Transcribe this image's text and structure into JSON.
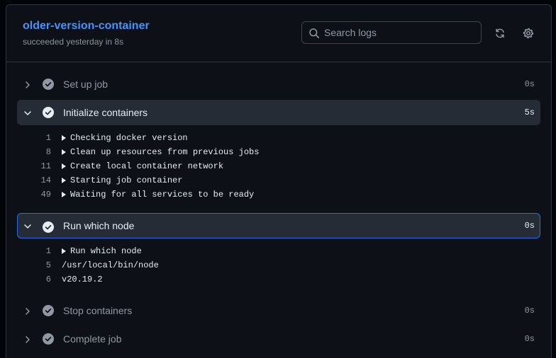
{
  "job": {
    "title": "older-version-container",
    "subtitle": "succeeded yesterday in 8s"
  },
  "search": {
    "placeholder": "Search logs",
    "value": ""
  },
  "icons": {
    "search": "search-icon",
    "refresh": "sync-icon",
    "settings": "gear-icon",
    "chevron_right": "chevron-right-icon",
    "chevron_down": "chevron-down-icon",
    "success": "check-circle-fill-icon"
  },
  "colors": {
    "link": "#4493f8",
    "active_border": "#1f6feb",
    "background": "#0d1117"
  },
  "steps": [
    {
      "name": "Set up job",
      "duration": "0s",
      "expanded": false
    },
    {
      "name": "Initialize containers",
      "duration": "5s",
      "expanded": true,
      "log": [
        {
          "n": "1",
          "text": "Checking docker version",
          "group": true
        },
        {
          "n": "8",
          "text": "Clean up resources from previous jobs",
          "group": true
        },
        {
          "n": "11",
          "text": "Create local container network",
          "group": true
        },
        {
          "n": "14",
          "text": "Starting job container",
          "group": true
        },
        {
          "n": "49",
          "text": "Waiting for all services to be ready",
          "group": true
        }
      ]
    },
    {
      "name": "Run which node",
      "duration": "0s",
      "expanded": true,
      "active": true,
      "log": [
        {
          "n": "1",
          "text": "Run which node",
          "group": true
        },
        {
          "n": "5",
          "text": "/usr/local/bin/node",
          "group": false
        },
        {
          "n": "6",
          "text": "v20.19.2",
          "group": false
        }
      ]
    },
    {
      "name": "Stop containers",
      "duration": "0s",
      "expanded": false
    },
    {
      "name": "Complete job",
      "duration": "0s",
      "expanded": false
    }
  ]
}
